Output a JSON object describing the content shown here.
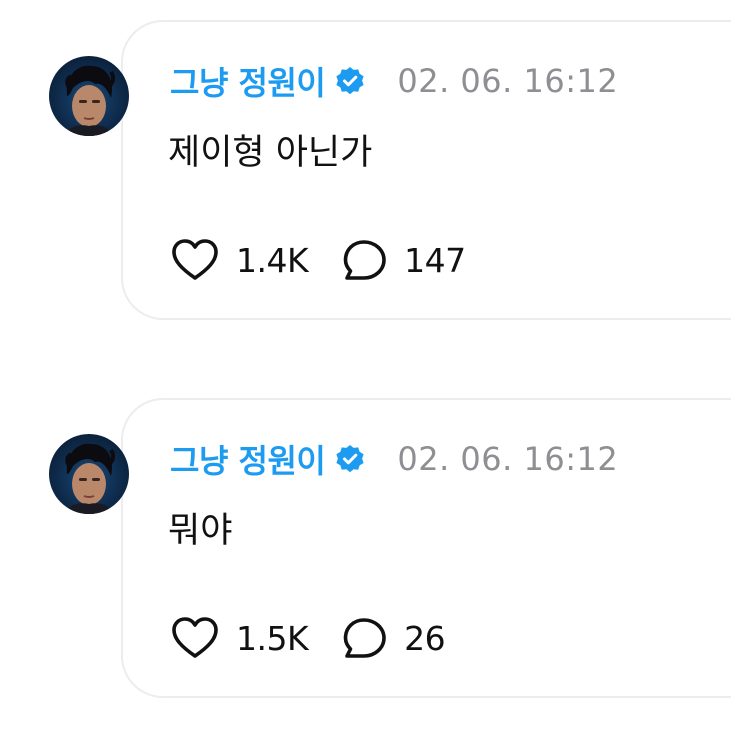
{
  "posts": [
    {
      "username": "그냥 정원이",
      "timestamp": "02. 06. 16:12",
      "message": "제이형 아닌가",
      "likes": "1.4K",
      "replies": "147"
    },
    {
      "username": "그냥 정원이",
      "timestamp": "02. 06. 16:12",
      "message": "뭐야",
      "likes": "1.5K",
      "replies": "26"
    }
  ],
  "icons": {
    "like": "heart-icon",
    "reply": "speech-bubble-icon",
    "verified": "verified-badge-icon"
  },
  "colors": {
    "username": "#1d9bf0",
    "verified_badge": "#1d9bf0",
    "timestamp": "#8e8e93",
    "text": "#111111",
    "card_border": "#ececf1"
  }
}
